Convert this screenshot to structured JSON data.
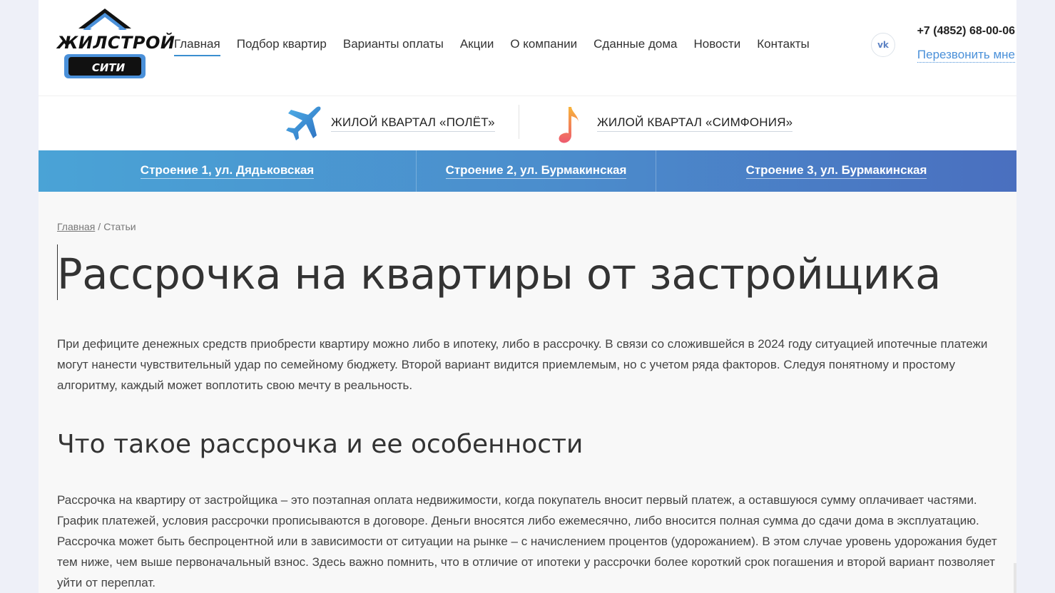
{
  "logo": {
    "top_text": "ЖИЛСТРОЙ",
    "bottom_text": "СИТИ"
  },
  "nav": {
    "items": [
      {
        "label": "Главная",
        "active": true
      },
      {
        "label": "Подбор квартир"
      },
      {
        "label": "Варианты оплаты"
      },
      {
        "label": "Акции"
      },
      {
        "label": "О компании"
      },
      {
        "label": "Сданные дома"
      },
      {
        "label": "Новости"
      },
      {
        "label": "Контакты"
      }
    ]
  },
  "social": {
    "vk_icon": "vk-icon"
  },
  "contacts": {
    "phone": "+7 (4852) 68-00-06",
    "callback": "Перезвонить мне"
  },
  "districts": [
    {
      "label": "ЖИЛОЙ КВАРТАЛ «ПОЛЁТ»",
      "icon": "airplane-icon"
    },
    {
      "label": "ЖИЛОЙ КВАРТАЛ «СИМФОНИЯ»",
      "icon": "music-note-icon"
    }
  ],
  "buildings": [
    {
      "label": "Строение 1, ул. Дядьковская"
    },
    {
      "label": "Строение 2, ул. Бурмакинская"
    },
    {
      "label": "Строение 3, ул. Бурмакинская"
    }
  ],
  "breadcrumb": {
    "home": "Главная",
    "separator": "/",
    "current": "Статьи"
  },
  "article": {
    "title": "Рассрочка на квартиры от застройщика",
    "intro": "При дефиците денежных средств приобрести квартиру можно либо в ипотеку, либо в рассрочку. В связи со сложившейся в 2024 году ситуацией ипотечные платежи могут нанести чувствительный удар по семейному бюджету. Второй вариант видится приемлемым, но с учетом ряда факторов. Следуя понятному и простому алгоритму, каждый может воплотить свою мечту в реальность.",
    "section_title": "Что такое рассрочка и ее особенности",
    "section_text": "Рассрочка на квартиру от застройщика – это поэтапная оплата недвижимости, когда покупатель вносит первый платеж, а оставшуюся сумму оплачивает частями. График платежей, условия рассрочки прописываются в договоре. Деньги вносятся либо ежемесячно, либо вносится полная сумма до сдачи дома в эксплуатацию. Рассрочка может быть беспроцентной или в зависимости от ситуации на рынке – с начислением процентов (удорожанием). В этом случае уровень удорожания будет тем ниже, чем выше первоначальный взнос. Здесь важно помнить, что в отличие от ипотеки у рассрочки более короткий срок погашения и второй вариант позволяет уйти от переплат."
  },
  "colors": {
    "accent": "#3a8fd0",
    "bar_start": "#4aa3d6",
    "bar_end": "#4a6fbf",
    "text": "#333333"
  }
}
